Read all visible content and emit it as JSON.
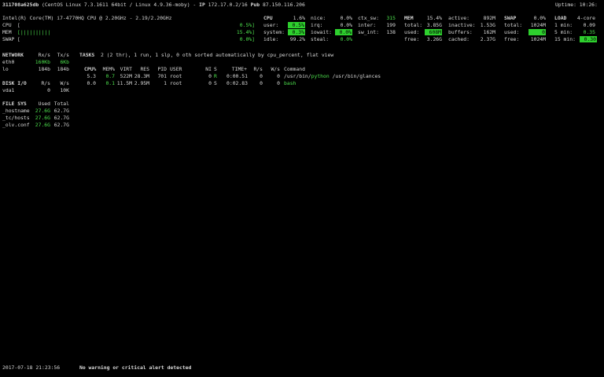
{
  "header": {
    "hostname": "311708a625db",
    "system": "(CentOS Linux 7.3.1611 64bit / Linux 4.9.36-moby)",
    "ip_sep": " - ",
    "ip_label": "IP",
    "ip_value": "172.17.0.2/16",
    "pub_label": "Pub",
    "pub_value": "87.150.116.206",
    "uptime": "Uptime: 10:26:"
  },
  "cpu_info": "Intel(R) Core(TM) i7-4770HQ CPU @ 2.20GHz - 2.19/2.20GHz",
  "quicklook": {
    "cpu_label": "CPU",
    "cpu_bar": "[",
    "cpu_value": "0.5%]",
    "mem_label": "MEM",
    "mem_bar": "[||||||||||",
    "mem_value": "15.4%]",
    "swap_label": "SWAP",
    "swap_bar": "[",
    "swap_value": "0.0%]"
  },
  "cpu": {
    "title": "CPU",
    "total": "1.6%",
    "rows": [
      {
        "l1": "user:",
        "v1": "0.5%",
        "l2": "nice:",
        "v2": "0.0%",
        "l3": "ctx_sw:",
        "v3": "315"
      },
      {
        "l1": "system:",
        "v1": "0.3%",
        "l2": "irq:",
        "v2": "0.0%",
        "l3": "inter:",
        "v3": "199"
      },
      {
        "l1": "idle:",
        "v1": "99.2%",
        "l2": "iowait:",
        "v2": "0.0%",
        "l3": "sw_int:",
        "v3": "138"
      },
      {
        "l1": "",
        "v1": "",
        "l2": "steal:",
        "v2": "0.0%",
        "l3": "",
        "v3": ""
      }
    ]
  },
  "mem": {
    "title": "MEM",
    "total": "15.4%",
    "rows": [
      {
        "l1": "total:",
        "v1": "3.85G",
        "l2": "active:",
        "v2": "892M"
      },
      {
        "l1": "used:",
        "v1": "608M",
        "l2": "inactive:",
        "v2": "1.53G"
      },
      {
        "l1": "free:",
        "v1": "3.26G",
        "l2": "buffers:",
        "v2": "162M"
      },
      {
        "l1": "",
        "v1": "",
        "l2": "cached:",
        "v2": "2.37G"
      }
    ]
  },
  "swap": {
    "title": "SWAP",
    "total": "0.0%",
    "rows": [
      {
        "l": "total:",
        "v": "1024M"
      },
      {
        "l": "used:",
        "v": "0"
      },
      {
        "l": "free:",
        "v": "1024M"
      }
    ]
  },
  "load": {
    "title": "LOAD",
    "cores": "4-core",
    "rows": [
      {
        "l": "1 min:",
        "v": "0.09"
      },
      {
        "l": "5 min:",
        "v": "0.35"
      },
      {
        "l": "15 min:",
        "v": "0.30"
      }
    ]
  },
  "network": {
    "title": "NETWORK",
    "rx": "Rx/s",
    "tx": "Tx/s",
    "rows": [
      {
        "name": "eth0",
        "rx": "160Kb",
        "tx": "6Kb"
      },
      {
        "name": "lo",
        "rx": "184b",
        "tx": "184b"
      }
    ]
  },
  "diskio": {
    "title": "DISK I/O",
    "r": "R/s",
    "w": "W/s",
    "rows": [
      {
        "name": "vda1",
        "r": "0",
        "w": "10K"
      }
    ]
  },
  "filesys": {
    "title": "FILE SYS",
    "used": "Used",
    "total": "Total",
    "rows": [
      {
        "name": "_hostname",
        "used": "27.6G",
        "total": "62.7G"
      },
      {
        "name": "_tc/hosts",
        "used": "27.6G",
        "total": "62.7G"
      },
      {
        "name": "_olv.conf",
        "used": "27.6G",
        "total": "62.7G"
      }
    ]
  },
  "tasks": {
    "title": "TASKS",
    "summary": "2 (2 thr), 1 run, 1 slp, 0 oth sorted automatically by cpu_percent, flat view"
  },
  "processes": {
    "headers": {
      "cpu": "CPU%",
      "mem": "MEM%",
      "virt": "VIRT",
      "res": "RES",
      "pid": "PID",
      "user": "USER",
      "ni": "NI",
      "s": "S",
      "time": "TIME+",
      "rs": "R/s",
      "ws": "W/s",
      "cmd": "Command"
    },
    "rows": [
      {
        "cpu": "5.3",
        "mem": "0.7",
        "virt": "522M",
        "res": "28.3M",
        "pid": "701",
        "user": "root",
        "ni": "0",
        "s": "R",
        "time": "0:00.51",
        "rs": "0",
        "ws": "0",
        "cmd_pre": "/usr/bin/",
        "cmd_hl": "python",
        "cmd_post": " /usr/bin/glances"
      },
      {
        "cpu": "0.0",
        "mem": "0.1",
        "virt": "11.5M",
        "res": "2.95M",
        "pid": "1",
        "user": "root",
        "ni": "0",
        "s": "S",
        "time": "0:02.83",
        "rs": "0",
        "ws": "0",
        "cmd_pre": "",
        "cmd_hl": "bash",
        "cmd_post": ""
      }
    ]
  },
  "footer": {
    "datetime": "2017-07-18 21:23:56",
    "alert": "No warning or critical alert detected"
  },
  "colors": {
    "background": "#000000",
    "text": "#d8d8d8",
    "ok": "#4de24d",
    "highlight": "#2ecf2e"
  }
}
